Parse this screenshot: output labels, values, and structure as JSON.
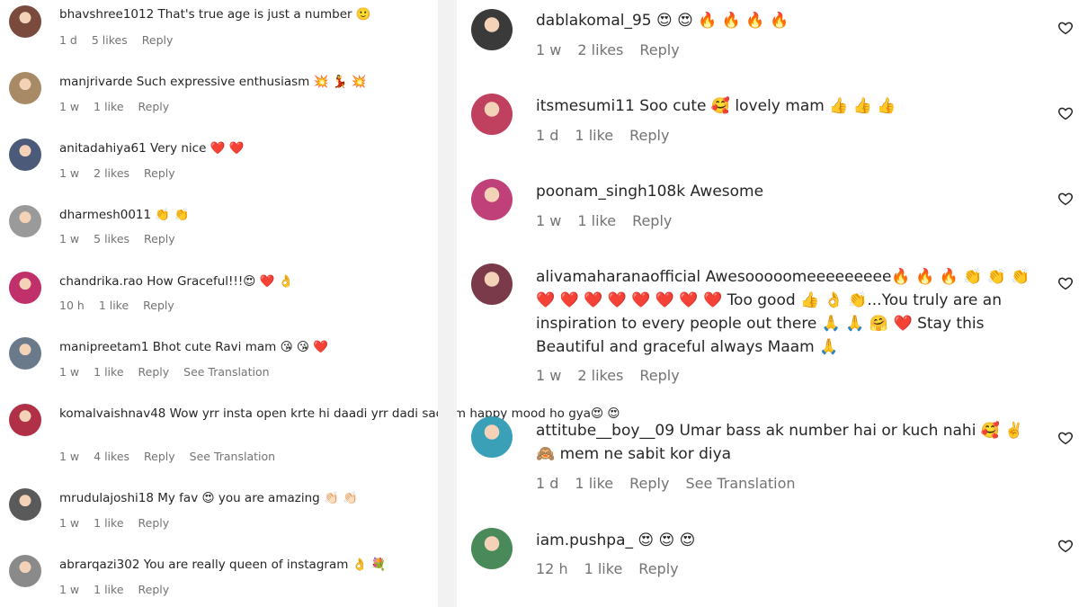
{
  "left_comments": [
    {
      "user": "bhavshree1012",
      "text": "That's true age is just a number 🙂",
      "time": "1 d",
      "likes": "5 likes",
      "reply": "Reply",
      "translation": "",
      "avatar_color": "#7a4a3c"
    },
    {
      "user": "manjrivarde",
      "text": "Such expressive enthusiasm 💥 💃 💥",
      "time": "1 w",
      "likes": "1 like",
      "reply": "Reply",
      "translation": "",
      "avatar_color": "#a88a66"
    },
    {
      "user": "anitadahiya61",
      "text": "Very nice ❤️ ❤️",
      "time": "1 w",
      "likes": "2 likes",
      "reply": "Reply",
      "translation": "",
      "avatar_color": "#4a5a78"
    },
    {
      "user": "dharmesh0011",
      "text": "👏 👏",
      "time": "1 w",
      "likes": "5 likes",
      "reply": "Reply",
      "translation": "",
      "avatar_color": "#9a9a9a"
    },
    {
      "user": "chandrika.rao",
      "text": "How Graceful!!!😍 ❤️ 👌",
      "time": "10 h",
      "likes": "1 like",
      "reply": "Reply",
      "translation": "",
      "avatar_color": "#c0306a"
    },
    {
      "user": "manipreetam1",
      "text": "Bhot cute Ravi mam 😘 😘 ❤️",
      "time": "1 w",
      "likes": "1 like",
      "reply": "Reply",
      "translation": "See Translation",
      "avatar_color": "#6a7a8a"
    },
    {
      "user": "komalvaishnav48",
      "text": "Wow yrr insta open krte hi daadi yrr dadi sach m happy mood ho gya😍 😍",
      "time": "1 w",
      "likes": "4 likes",
      "reply": "Reply",
      "translation": "See Translation",
      "avatar_color": "#b03048"
    },
    {
      "user": "mrudulajoshi18",
      "text": "My fav 😍 you are amazing 👏🏻 👏🏻",
      "time": "1 w",
      "likes": "1 like",
      "reply": "Reply",
      "translation": "",
      "avatar_color": "#5a5a5a"
    },
    {
      "user": "abrarqazi302",
      "text": "You are really queen of instagram 👌 💐",
      "time": "1 w",
      "likes": "1 like",
      "reply": "Reply",
      "translation": "",
      "avatar_color": "#8a8a8a"
    }
  ],
  "right_comments": [
    {
      "user": "dablakomal_95",
      "text": "😍 😍 🔥 🔥 🔥 🔥",
      "time": "1 w",
      "likes": "2 likes",
      "reply": "Reply",
      "translation": "",
      "avatar_color": "#3a3a3a"
    },
    {
      "user": "itsmesumi11",
      "text": "Soo cute 🥰 lovely mam 👍 👍 👍",
      "time": "1 d",
      "likes": "1 like",
      "reply": "Reply",
      "translation": "",
      "avatar_color": "#c04060"
    },
    {
      "user": "poonam_singh108k",
      "text": "Awesome",
      "time": "1 w",
      "likes": "1 like",
      "reply": "Reply",
      "translation": "",
      "avatar_color": "#c0407a"
    },
    {
      "user": "alivamaharanaofficial",
      "text": "Awesooooomeeeeeeeee🔥 🔥 🔥 👏 👏 👏 ❤️ ❤️ ❤️ ❤️ ❤️ ❤️ ❤️ ❤️ Too good 👍 👌 👏...You truly are an inspiration to every people out there 🙏 🙏 🤗 ❤️ Stay this Beautiful and graceful always Maam 🙏",
      "time": "1 w",
      "likes": "2 likes",
      "reply": "Reply",
      "translation": "",
      "avatar_color": "#7a3a4a"
    },
    {
      "user": "attitube__boy__09",
      "text": "Umar bass ak number hai or kuch nahi 🥰 ✌️ 🙈 mem ne sabit kor diya",
      "time": "1 d",
      "likes": "1 like",
      "reply": "Reply",
      "translation": "See Translation",
      "avatar_color": "#3aa0b8"
    },
    {
      "user": "iam.pushpa_",
      "text": "😍 😍 😍",
      "time": "12 h",
      "likes": "1 like",
      "reply": "Reply",
      "translation": "",
      "avatar_color": "#4a8a5a"
    }
  ]
}
